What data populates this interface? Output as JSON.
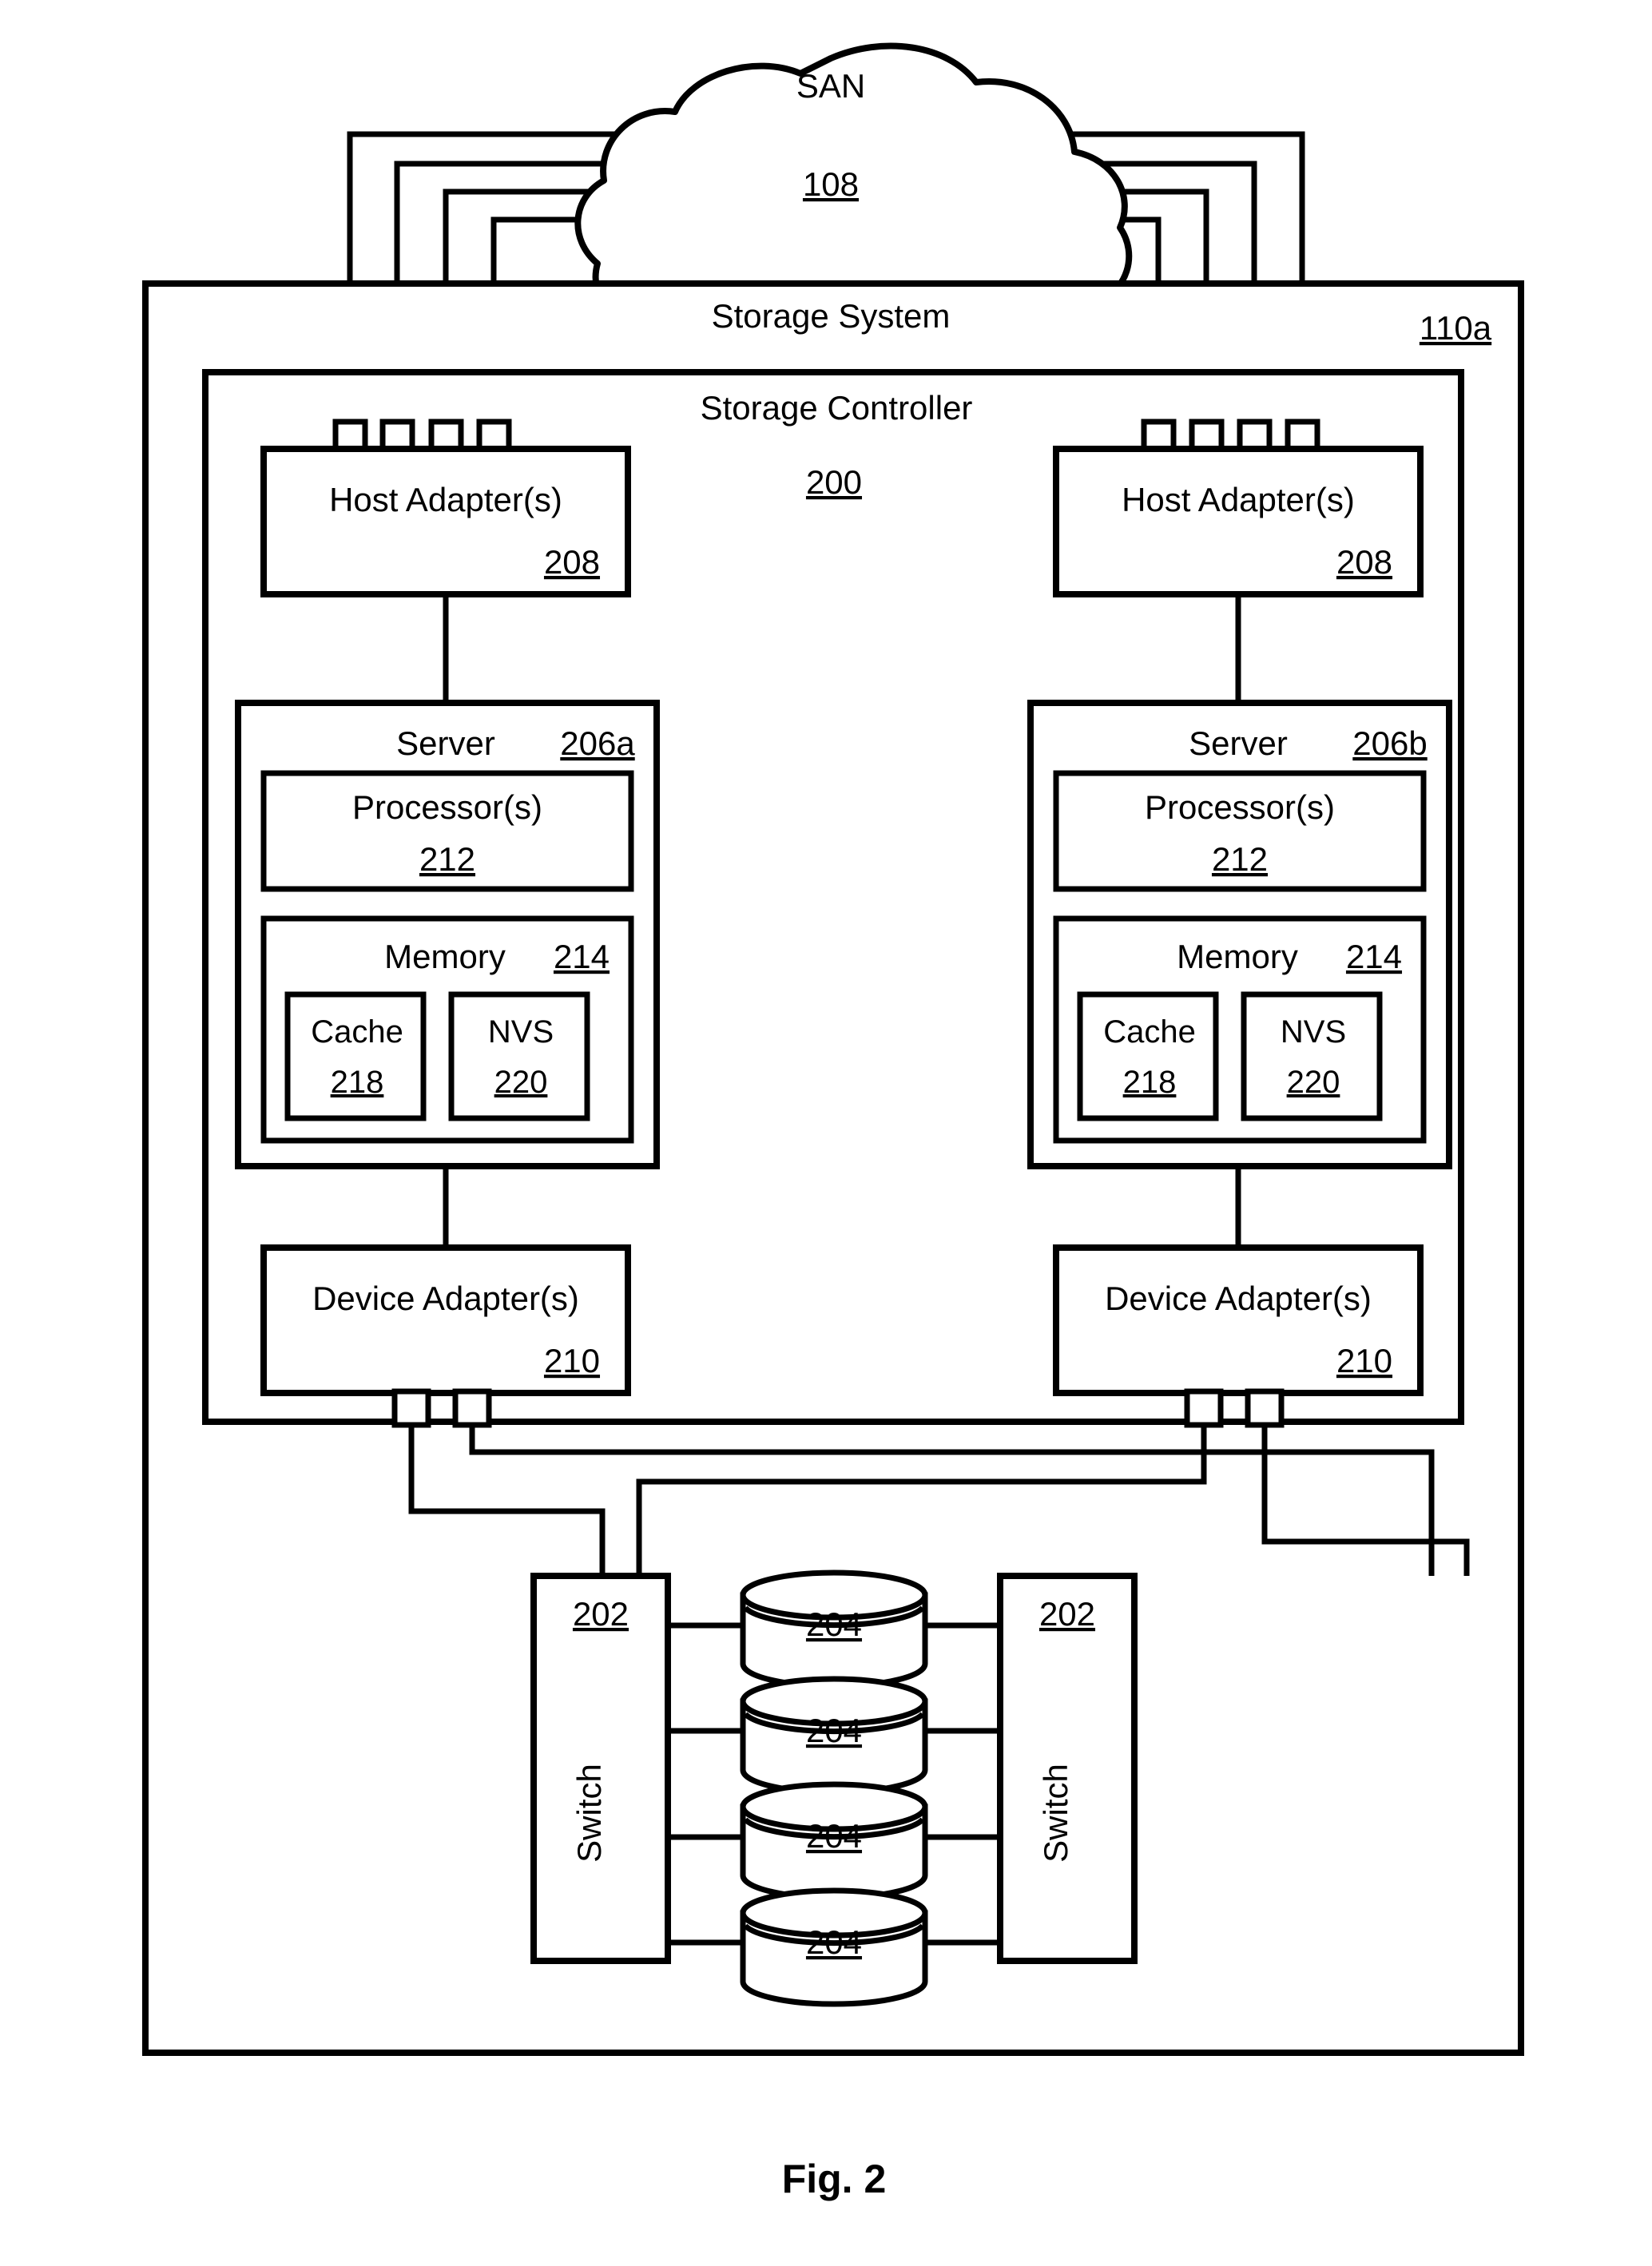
{
  "figure": {
    "caption": "Fig. 2"
  },
  "san": {
    "label": "SAN",
    "ref": "108"
  },
  "storage_system": {
    "label": "Storage System",
    "ref": "110a"
  },
  "storage_controller": {
    "label": "Storage Controller",
    "ref": "200"
  },
  "host_adapters": [
    {
      "label": "Host Adapter(s)",
      "ref": "208",
      "side": "left",
      "port_count": 4
    },
    {
      "label": "Host Adapter(s)",
      "ref": "208",
      "side": "right",
      "port_count": 4
    }
  ],
  "servers": [
    {
      "label": "Server",
      "ref": "206a",
      "processor": {
        "label": "Processor(s)",
        "ref": "212"
      },
      "memory": {
        "label": "Memory",
        "ref": "214",
        "cache": {
          "label": "Cache",
          "ref": "218"
        },
        "nvs": {
          "label": "NVS",
          "ref": "220"
        }
      }
    },
    {
      "label": "Server",
      "ref": "206b",
      "processor": {
        "label": "Processor(s)",
        "ref": "212"
      },
      "memory": {
        "label": "Memory",
        "ref": "214",
        "cache": {
          "label": "Cache",
          "ref": "218"
        },
        "nvs": {
          "label": "NVS",
          "ref": "220"
        }
      }
    }
  ],
  "device_adapters": [
    {
      "label": "Device Adapter(s)",
      "ref": "210",
      "side": "left",
      "port_count": 2
    },
    {
      "label": "Device Adapter(s)",
      "ref": "210",
      "side": "right",
      "port_count": 2
    }
  ],
  "switches": [
    {
      "label": "Switch",
      "ref": "202",
      "side": "left"
    },
    {
      "label": "Switch",
      "ref": "202",
      "side": "right"
    }
  ],
  "storage_drives": [
    {
      "ref": "204"
    },
    {
      "ref": "204"
    },
    {
      "ref": "204"
    },
    {
      "ref": "204"
    }
  ],
  "colors": {
    "stroke": "#000000",
    "fill": "#ffffff"
  }
}
